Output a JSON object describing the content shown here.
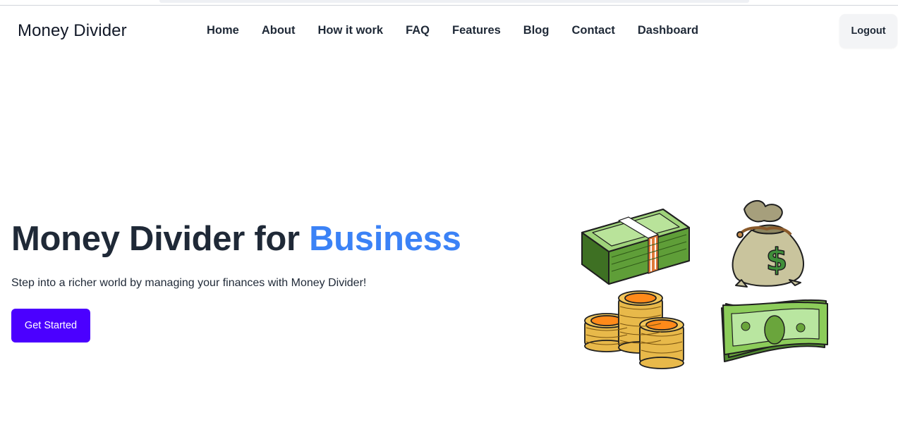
{
  "brand": {
    "name": "Money Divider"
  },
  "nav": {
    "items": [
      {
        "label": "Home"
      },
      {
        "label": "About"
      },
      {
        "label": "How it work"
      },
      {
        "label": "FAQ"
      },
      {
        "label": "Features"
      },
      {
        "label": "Blog"
      },
      {
        "label": "Contact"
      },
      {
        "label": "Dashboard"
      }
    ],
    "logout_label": "Logout"
  },
  "hero": {
    "title_main": "Money Divider for",
    "title_accent": "Business",
    "subtitle": "Step into a richer world by managing your finances with Money Divider!",
    "cta_label": "Get Started"
  },
  "colors": {
    "accent_text": "#3b82f6",
    "cta_background": "#4b00ff",
    "logout_background": "#f3f4f6"
  },
  "illustration": {
    "icons": [
      "cash-stack-icon",
      "money-bag-icon",
      "coin-stacks-icon",
      "banknote-icon"
    ]
  }
}
